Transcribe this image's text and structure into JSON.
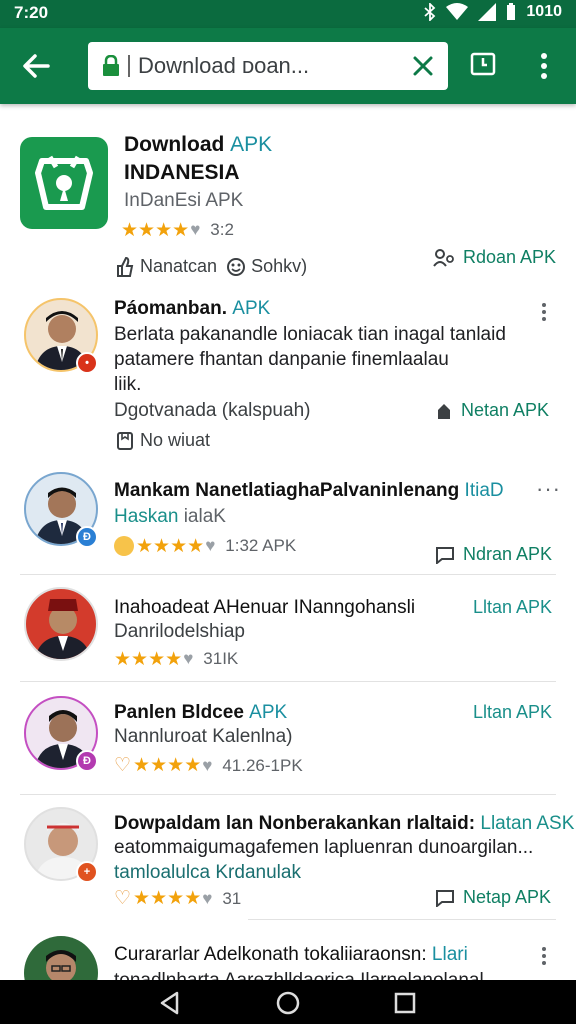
{
  "status": {
    "time": "7:20",
    "battery": "1010"
  },
  "search": {
    "text": "Download ᴅᴏan..."
  },
  "featured": {
    "title_a": "Download ",
    "title_apk": "APK",
    "title_b": "INDANESIA",
    "subtitle": "InDanEsi APK",
    "rating": "3:2",
    "stars_filled": 4,
    "meta_a": "Nanatcan",
    "meta_b": "Sohkv)",
    "action": "Rdoan APK"
  },
  "items": [
    {
      "title": "Páomanban.",
      "title_apk": "APK",
      "desc_1": "Berlata pakanandle loniacak tian inagal tanlaid",
      "desc_2": "patamere fhantan danpanie finemlaalau",
      "desc_3": "liik.",
      "meta": "Dgotvanada (kalspuah)",
      "action": "Netan APK",
      "extra": "No wiuat"
    },
    {
      "title": "Mankam NanetlatiaghaPalvaninlenang",
      "title_link": "ItiaD",
      "sub_teal": "Haskan",
      "sub_rest": " ialaK",
      "rating": "1:32 APK",
      "action": "Ndran APK"
    },
    {
      "title": "Inahoadeat AHenuar INanngohansli",
      "sub": "Danrilodelshiap",
      "rating": "31IK",
      "action": "Lltan APK"
    },
    {
      "title": "Panlen Bldcee",
      "title_apk": "APK",
      "sub": "Nannluroat Kalenlna)",
      "rating": "41.26-1PK",
      "action": "Lltan APK"
    },
    {
      "title": "Dowpaldam lan Nonberakankan rlaltaid:",
      "title_link": "Llatan ASK",
      "desc_1": "eatommaigumagafemen lapluenran dunoargilan...",
      "desc_2": "tamloalulca Krdanulak",
      "rating": "31",
      "action": "Netap APK"
    },
    {
      "title": "Curararlar Adelkonath tokaliiaraonsn:",
      "title_link": "Llari",
      "desc_1": "tonadlnharta Aarezhlldaorica Ilarnelanolanal"
    }
  ],
  "colors": {
    "appbar": "#0d7a47",
    "statusbar": "#0b6b3f",
    "star": "#f2a20c",
    "teal": "#1a8f8a",
    "link": "#1a8fa0"
  },
  "icons": [
    "back-arrow-icon",
    "lock-icon",
    "close-icon",
    "bookmark-icon",
    "more-vert-icon",
    "star-icon",
    "thumb-icon",
    "face-icon",
    "person-search-icon",
    "phone-icon",
    "chat-icon"
  ]
}
